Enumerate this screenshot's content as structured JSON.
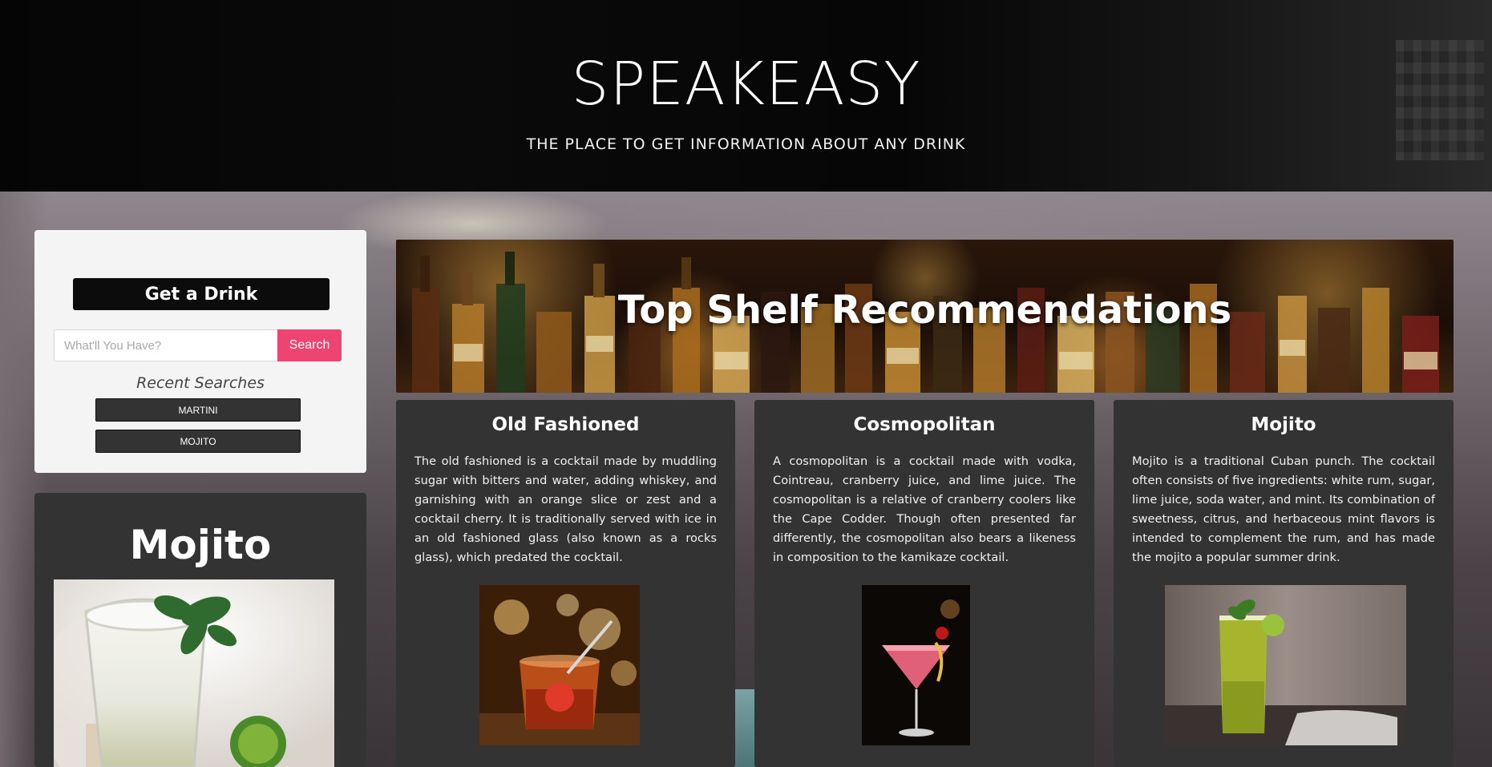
{
  "header": {
    "title": "SPEAKEASY",
    "subtitle": "THE PLACE TO GET INFORMATION ABOUT ANY DRINK"
  },
  "search_panel": {
    "get_drink_label": "Get a Drink",
    "search_placeholder": "What'll You Have?",
    "search_button_label": "Search",
    "recent_title": "Recent Searches",
    "recent_items": [
      "MARTINI",
      "MOJITO"
    ]
  },
  "featured": {
    "title": "Mojito",
    "image_icon": "mojito-glass-photo"
  },
  "banner": {
    "title": "Top Shelf Recommendations"
  },
  "drinks": [
    {
      "name": "Old Fashioned",
      "description": "The old fashioned is a cocktail made by muddling sugar with bitters and water, adding whiskey, and garnishing with an orange slice or zest and a cocktail cherry. It is traditionally served with ice in an old fashioned glass (also known as a rocks glass), which predated the cocktail.",
      "image_icon": "old-fashioned-photo"
    },
    {
      "name": "Cosmopolitan",
      "description": "A cosmopolitan is a cocktail made with vodka, Cointreau, cranberry juice, and lime juice. The cosmopolitan is a relative of cranberry coolers like the Cape Codder. Though often presented far differently, the cosmopolitan also bears a likeness in composition to the kamikaze cocktail.",
      "image_icon": "cosmopolitan-photo"
    },
    {
      "name": "Mojito",
      "description": "Mojito is a traditional Cuban punch. The cocktail often consists of five ingredients: white rum, sugar, lime juice, soda water, and mint. Its combination of sweetness, citrus, and herbaceous mint flavors is intended to complement the rum, and has made the mojito a popular summer drink.",
      "image_icon": "mojito-photo"
    }
  ],
  "colors": {
    "search_button": "#ef4471",
    "card_background": "#333333",
    "panel_background": "#f4f4f5"
  }
}
